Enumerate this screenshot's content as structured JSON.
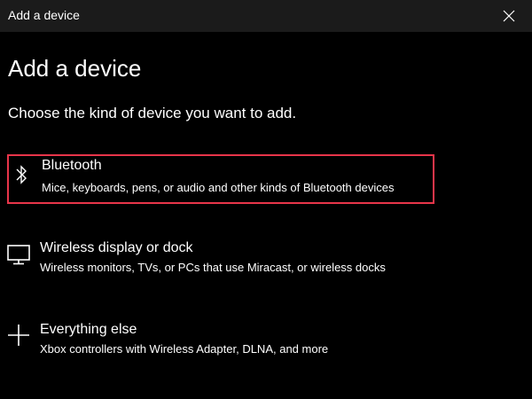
{
  "window": {
    "title": "Add a device",
    "close_icon": "close-icon"
  },
  "page": {
    "title": "Add a device",
    "subtitle": "Choose the kind of device you want to add."
  },
  "options": [
    {
      "title": "Bluetooth",
      "description": "Mice, keyboards, pens, or audio and other kinds of Bluetooth devices",
      "icon": "bluetooth-icon",
      "selected": true
    },
    {
      "title": "Wireless display or dock",
      "description": "Wireless monitors, TVs, or PCs that use Miracast, or wireless docks",
      "icon": "monitor-icon",
      "selected": false
    },
    {
      "title": "Everything else",
      "description": "Xbox controllers with Wireless Adapter, DLNA, and more",
      "icon": "plus-icon",
      "selected": false
    }
  ],
  "colors": {
    "background": "#000000",
    "titlebar": "#1b1b1b",
    "text": "#ffffff",
    "highlight_border": "#e8354a"
  }
}
